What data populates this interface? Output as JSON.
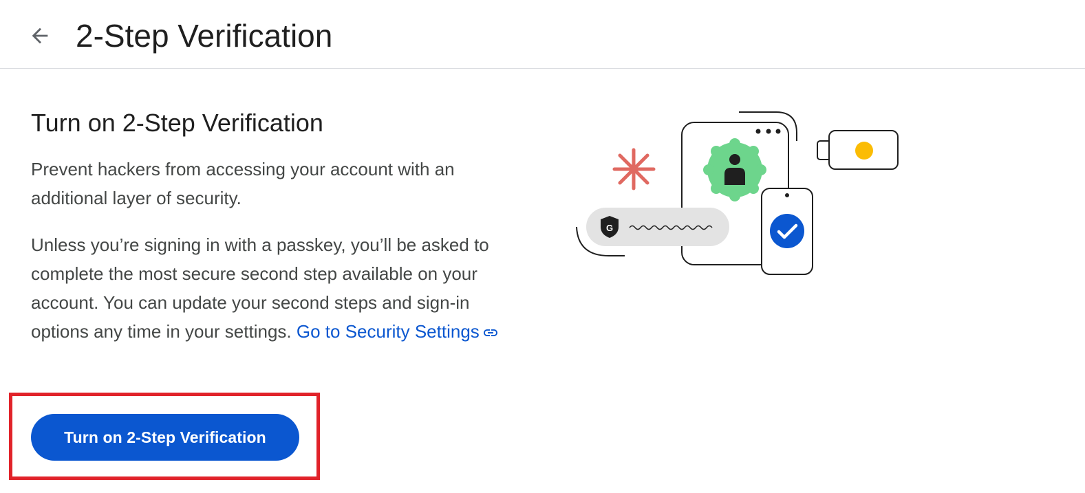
{
  "header": {
    "title": "2-Step Verification",
    "back_icon": "arrow-back-icon"
  },
  "main": {
    "section_title": "Turn on 2-Step Verification",
    "intro_text": "Prevent hackers from accessing your account with an additional layer of security.",
    "detail_text": "Unless you’re signing in with a passkey, you’ll be asked to complete the most secure second step available on your account. You can update your second steps and sign-in options any time in your settings.",
    "link_text": "Go to Security Settings",
    "link_icon": "link-icon",
    "button_label": "Turn on 2-Step Verification"
  },
  "illustration": {
    "shield_letter": "G",
    "icons": [
      "asterisk-icon",
      "person-icon",
      "shield-icon",
      "checkmark-icon",
      "security-key-icon",
      "phone-icon"
    ]
  },
  "colors": {
    "accent": "#0b57d0",
    "highlight": "#e1232a",
    "avatar_badge": "#6dd58c",
    "asterisk": "#e06961",
    "key_dot": "#fbbc04",
    "pill": "#e3e3e3"
  }
}
